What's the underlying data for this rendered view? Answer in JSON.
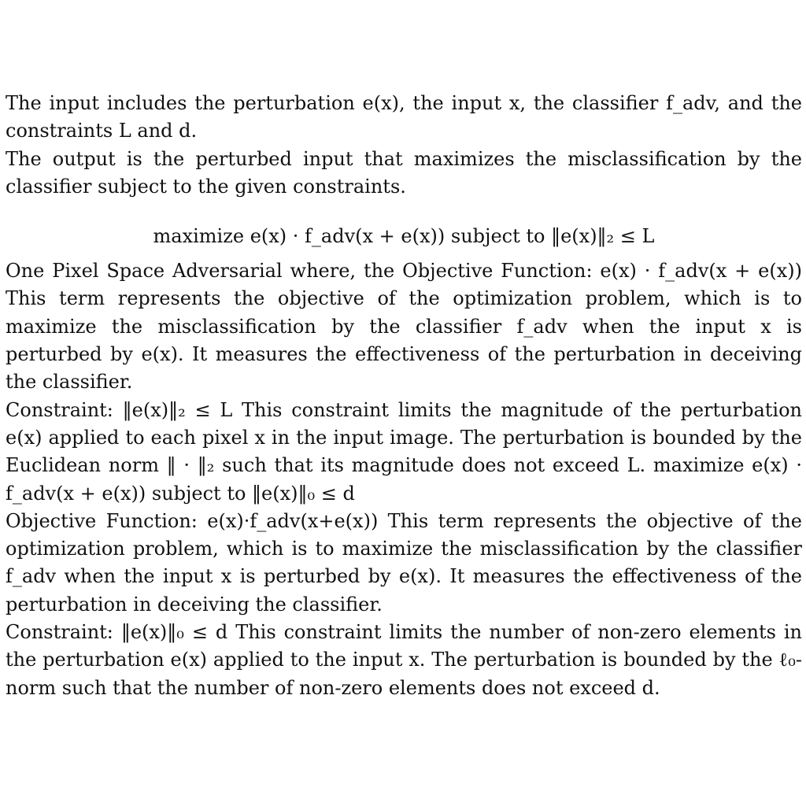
{
  "paragraphs": {
    "p1": "The input includes the perturbation e(x), the input x, the classifier f_adv, and the constraints L and d.",
    "p2": "The output is the perturbed input that maximizes the misclassification by the classifier subject to the given constraints.",
    "eq1": "maximize   e(x) · f_adv(x + e(x))   subject to   ‖e(x)‖₂ ≤ L",
    "p3": "One Pixel Space Adversarial where, the Objective Function: e(x) · f_adv(x + e(x)) This term represents the objective of the optimization problem, which is to maximize the misclassification by the classifier f_adv when the input x is perturbed by e(x). It measures the effectiveness of the perturbation in deceiving the classifier.",
    "p4": "Constraint: ‖e(x)‖₂ ≤ L This constraint limits the magnitude of the perturbation e(x) applied to each pixel x in the input image. The perturbation is bounded by the Euclidean norm ‖ · ‖₂ such that its magnitude does not exceed L. maximize   e(x) · f_adv(x + e(x))   subject to   ‖e(x)‖₀ ≤ d",
    "p5": "Objective Function: e(x)·f_adv(x+e(x)) This term represents the objective of the optimization problem, which is to maximize the misclassification by the classifier f_adv when the input x is perturbed by e(x). It measures the effectiveness of the perturbation in deceiving the classifier.",
    "p6": "Constraint: ‖e(x)‖₀ ≤ d This constraint limits the number of non-zero elements in the perturbation e(x) applied to the input x. The perturbation is bounded by the ℓ₀-norm such that the number of non-zero elements does not exceed d."
  }
}
